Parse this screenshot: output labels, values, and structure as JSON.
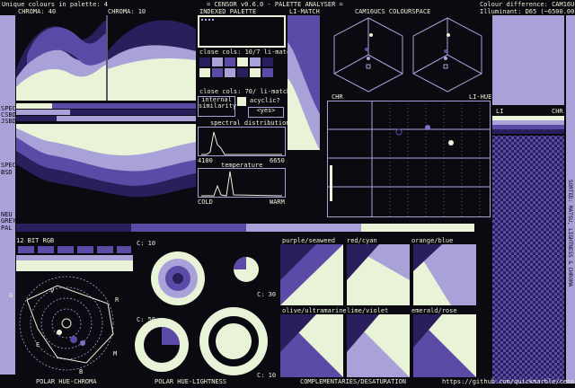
{
  "header": {
    "unique_colours": "Unique colours in palette: 4",
    "chroma_left": "CHROMA: 40",
    "chroma_right": "CHROMA: 10",
    "title": "= CENSOR v0.6.0 - PALETTE ANALYSER =",
    "indexed_palette": "INDEXED PALETTE",
    "li_match": "LI-MATCH",
    "colourspace": "CAM16UCS COLOURSPACE",
    "colour_difference": "Colour difference: CAM16UCS",
    "illuminant": "Illuminant: D65 (~6500.00 K)"
  },
  "left_labels": {
    "spec": "SPEC",
    "csbd": "CSBD",
    "jsbd": "JSBD",
    "spec2": "SPEC",
    "bsd": "BSD",
    "neu": "NEU",
    "grey": "GREY",
    "pal": "PAL"
  },
  "palette_panel": {
    "close_cols_1": "close cols: 10/7 li-match",
    "close_cols_2": "close cols: 70/ li-match",
    "internal_similarity": "internal similarity",
    "acyclic": "acyclic?",
    "yes": "<yes>",
    "spectral_distribution": "spectral distribution",
    "spec_min": "4100",
    "spec_max": "6650",
    "temperature": "temperature",
    "cold": "COLD",
    "warm": "WARM"
  },
  "chr_panel": {
    "chr": "CHR",
    "li_hue": "LI-HUE"
  },
  "right_panel": {
    "li": "LI",
    "chr": "CHR",
    "vertical_label": "SORTED: MATSU, LIGHTNESS & CHROMA"
  },
  "bottom": {
    "rgb_label": "12 BIT RGB",
    "polar_hue_chroma": "POLAR HUE-CHROMA",
    "polar_hue_lightness": "POLAR HUE-LIGHTNESS",
    "complementaries": "COMPLEMENTARIES/DESATURATION",
    "url": "https://github.com/quickmarble/censor",
    "c10a": "C: 10",
    "c30": "C: 30",
    "c50": "C: 50",
    "c10b": "C: 10",
    "hue_letters": [
      "G",
      "V",
      "R",
      "E",
      "B",
      "M"
    ],
    "comp_labels": [
      "purple/seaweed",
      "red/cyan",
      "orange/blue",
      "olive/ultramarine",
      "lime/violet",
      "emerald/rose"
    ]
  },
  "colors": {
    "bg": "#0a0a10",
    "lavender": "#a9a2d9",
    "cream": "#e8f3d7",
    "purple": "#5c4ba6",
    "dark_purple": "#2a1f5c"
  }
}
